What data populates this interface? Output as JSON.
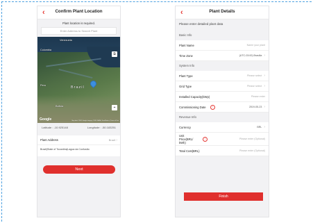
{
  "screen1": {
    "title": "Confirm Plant Location",
    "back_icon": "‹",
    "required_note": "Plant location is required.",
    "search_placeholder": "Enter Address to Search Plant",
    "map_labels": {
      "venezuela": "Venezuela",
      "colombia": "Colombia",
      "brazil": "Brazil",
      "bolivia": "Bolivia",
      "peru": "Peru",
      "google": "Google",
      "copyright": "Map data ©2019 Google Imagery ©2019 NASA, TerraMetrics | Terms of Use"
    },
    "latitude": "Latitude : -10.925148",
    "longitude": "Longitude : -50.183251",
    "address_label": "Plant Address",
    "address_country": "Brazil",
    "address_text": "Brazil|State of Tocantins|Lagoa da Confusão",
    "next_label": "Next"
  },
  "screen2": {
    "title": "Plant Details",
    "back_icon": "‹",
    "intro": "Please enter detailed plant data",
    "sections": {
      "basic": "Basic Info",
      "system": "System Info",
      "revenue": "Revenue Info"
    },
    "fields": {
      "plant_name": {
        "label": "Plant Name",
        "value": "Name your plant"
      },
      "time_zone": {
        "label": "Time Zone",
        "value": "(UTC-03:00) Brasilia"
      },
      "plant_type": {
        "label": "Plant Type",
        "value": "Please select"
      },
      "grid_type": {
        "label": "Grid Type",
        "value": "Please select"
      },
      "installed_capacity": {
        "label": "Installed Capacity(kWp)",
        "value": "Please enter"
      },
      "commissioning_date": {
        "label": "Commissioning Date",
        "value": "2019-05-23"
      },
      "currency": {
        "label": "Currency",
        "value": "BRL"
      },
      "unit_price": {
        "label": "Unit Price(BRL/ kWh)",
        "value": "Please enter (Optional)"
      },
      "total_cost": {
        "label": "Total Cost(BRL)",
        "value": "Please enter (Optional)"
      }
    },
    "finish_label": "Finish"
  },
  "colors": {
    "accent": "#e0302d",
    "pin": "#3c8fe0",
    "frame_outline": "#4a9fe0"
  },
  "icons": {
    "chevron": "›",
    "info": "!",
    "layers": "⧉",
    "locate": "⌖"
  }
}
